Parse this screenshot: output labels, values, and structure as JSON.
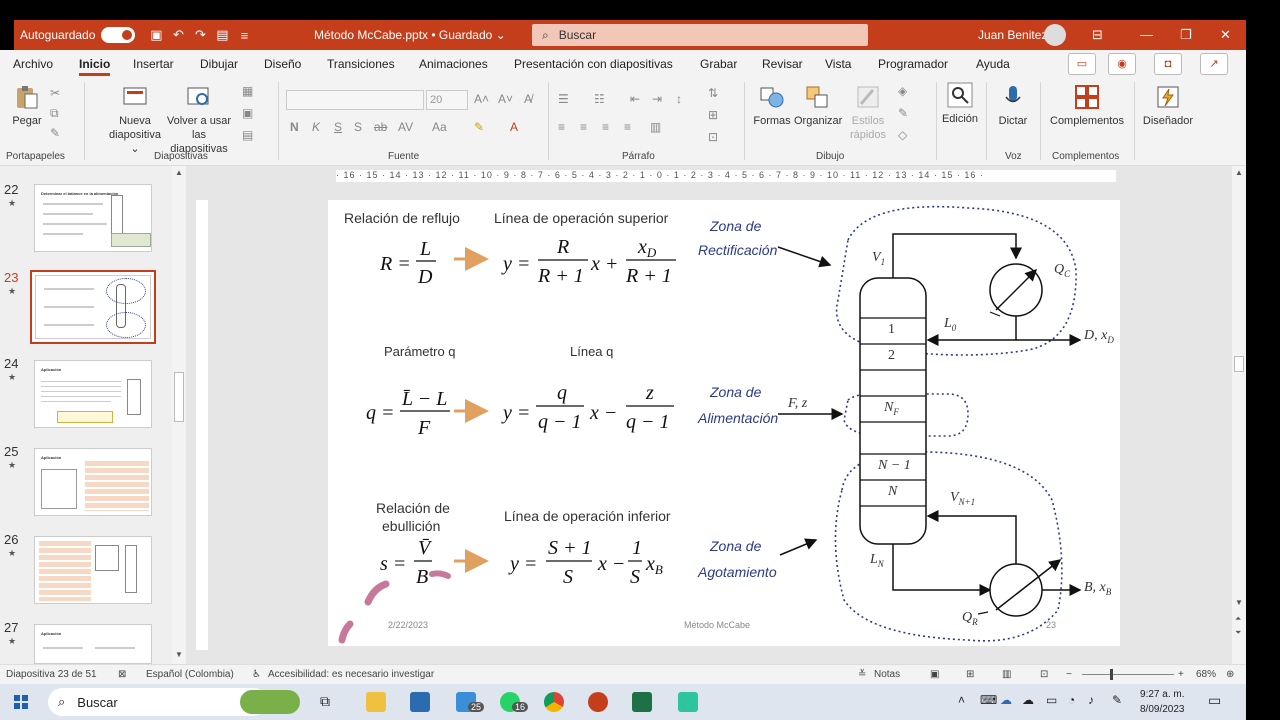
{
  "titlebar": {
    "autosave": "Autoguardado",
    "doc_title": "Método McCabe.pptx • Guardado ⌄",
    "search_placeholder": "Buscar",
    "user": "Juan Benitez"
  },
  "menu": {
    "tabs": [
      "Archivo",
      "Inicio",
      "Insertar",
      "Dibujar",
      "Diseño",
      "Transiciones",
      "Animaciones",
      "Presentación con diapositivas",
      "Grabar",
      "Revisar",
      "Vista",
      "Programador",
      "Ayuda"
    ],
    "active": "Inicio"
  },
  "ribbon": {
    "paste": "Pegar",
    "clipboard_group": "Portapapeles",
    "new_slide": "Nueva diapositiva ⌄",
    "reuse_slides": "Volver a usar las diapositivas",
    "slides_group": "Diapositivas",
    "font_size": "20",
    "font_group": "Fuente",
    "paragraph_group": "Párrafo",
    "shapes": "Formas",
    "arrange": "Organizar",
    "quick_styles": "Estilos rápidos",
    "drawing_group": "Dibujo",
    "editing": "Edición",
    "dictate": "Dictar",
    "voice_group": "Voz",
    "addins": "Complementos",
    "addins_group": "Complementos",
    "designer": "Diseñador"
  },
  "thumbnails": [
    {
      "num": "22",
      "title": "Determinar el balance en la alimentación"
    },
    {
      "num": "23",
      "title": ""
    },
    {
      "num": "24",
      "title": "Aplicación"
    },
    {
      "num": "25",
      "title": "Aplicación"
    },
    {
      "num": "26",
      "title": ""
    },
    {
      "num": "27",
      "title": "Aplicación"
    }
  ],
  "ruler_text": "· 16 · 15 · 14 · 13 · 12 · 11 · 10 · 9 · 8 · 7 · 6 · 5 · 4 · 3 · 2 · 1 · 0 · 1 · 2 · 3 · 4 · 5 · 6 · 7 · 8 · 9 · 10 · 11 · 12 · 13 · 14 · 15 · 16 ·",
  "slide": {
    "label_reflux": "Relación de reflujo",
    "label_upper": "Línea de operación superior",
    "label_q": "Parámetro q",
    "label_qline": "Línea q",
    "label_boil_1": "Relación de",
    "label_boil_2": "ebullición",
    "label_lower": "Línea de operación inferior",
    "zone_rect_1": "Zona de",
    "zone_rect_2": "Rectificación",
    "zone_feed_1": "Zona de",
    "zone_feed_2": "Alimentación",
    "zone_strip_1": "Zona de",
    "zone_strip_2": "Agotamiento",
    "date": "2/22/2023",
    "footer": "Método McCabe",
    "page": "23",
    "stage_1": "1",
    "stage_2": "2",
    "stage_nf": "N",
    "stage_n1": "N − 1",
    "stage_n": "N",
    "lbl_v1": "V",
    "lbl_qc": "Q",
    "lbl_l0": "L",
    "lbl_d": "D, x",
    "lbl_fz": "F, z",
    "lbl_vn1": "V",
    "lbl_ln": "L",
    "lbl_qr": "Q",
    "lbl_b": "B, x"
  },
  "status": {
    "slide_of": "Diapositiva 23 de 51",
    "language": "Español (Colombia)",
    "accessibility": "Accesibilidad: es necesario investigar",
    "notes": "Notas",
    "zoom": "68%"
  },
  "taskbar": {
    "search": "Buscar",
    "time": "9:27 a. m.",
    "date": "8/09/2023",
    "badge_a": "25",
    "badge_b": "16"
  },
  "colors": {
    "accent": "#c43e1c",
    "arrow_orange": "#e0a060",
    "zone_blue": "#2b3a8c"
  }
}
